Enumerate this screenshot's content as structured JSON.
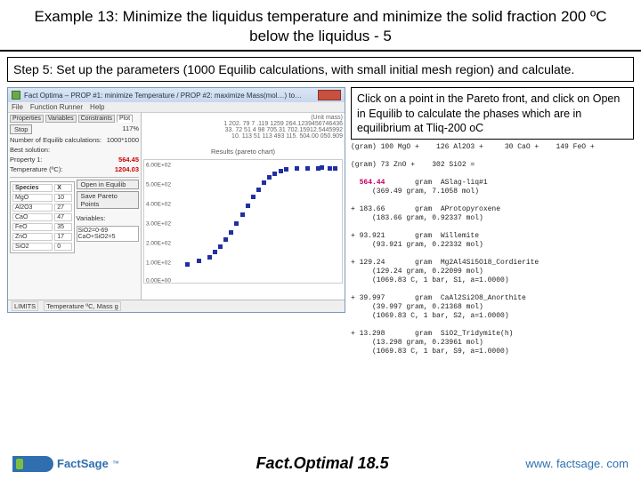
{
  "title": "Example 13: Minimize the liquidus temperature and minimize the solid fraction 200 ºC below the liquidus - 5",
  "step": "Step 5: Set up the parameters (1000 Equilib calculations, with small initial mesh region) and calculate.",
  "hint": "Click on a point in the Pareto front, and click on Open in Equilib to calculate the phases which are in equilibrium at Tliq-200 oC",
  "win": {
    "title": "Fact Optima – PROP #1: minimize Temperature / PROP #2: maximize Mass(mol…) to…",
    "menu": [
      "File",
      "Function Runner",
      "Help"
    ],
    "tabs": [
      "Properties",
      "Variables",
      "Constraints",
      "Plot"
    ],
    "stop": "Stop",
    "pct": "117%",
    "calc_label": "Number of Equilib calculations:",
    "calc_value": "1000*1000",
    "best_label": "Best solution:",
    "prop1_label": "Property 1:",
    "prop1_value": "564.45",
    "prop2_label": "Temperature (ºC):",
    "prop2_value": "1204.03",
    "grid_header": [
      "Species",
      "X"
    ],
    "grid_rows_left": [
      "MgO",
      "Al2O3",
      "CaO",
      "FeO",
      "ZnO",
      "SiO2"
    ],
    "grid_buttons": [
      "Open in Equilib",
      "Save Pareto Points"
    ],
    "variables_label": "Variables:",
    "variables_rows": [
      "SiO2=0-69",
      "CaO+SiO2=5"
    ],
    "status_line1": "1  202. 79 7 .119  1259  264.1239456746436",
    "status_line2": "33.  72  51   4   98  705.31  702.15912.5445992",
    "status_line3": "10.  113  51  113  493  115.  504.00  050.909",
    "status_units": "(Unit mass)",
    "chart_title": "Results (pareto chart)",
    "statusbar": [
      "LIMITS",
      "Temperature ºC, Mass g"
    ]
  },
  "mono_lines": [
    "(gram) 100 MgO +    126 Al2O3 +     30 CaO +    149 FeO +",
    "",
    "(gram) 73 ZnO +    302 SiO2 =",
    "",
    "  <HL>564.44</HL>       gram  ASlag-liq#1",
    "     (369.49 gram, 7.1058 mol)",
    "",
    "+ 183.66       gram  AProtopyroxene",
    "     (183.66 gram, 0.92337 mol)",
    "",
    "+ 93.921       gram  Willemite",
    "     (93.921 gram, 0.22332 mol)",
    "",
    "+ 129.24       gram  Mg2Al4Si5O18_Cordierite",
    "     (129.24 gram, 0.22099 mol)",
    "     (1069.83 C, 1 bar, S1, a=1.0000)",
    "",
    "+ 39.997       gram  CaAl2Si2O8_Anorthite",
    "     (39.997 gram, 0.21368 mol)",
    "     (1069.83 C, 1 bar, S2, a=1.0000)",
    "",
    "+ 13.298       gram  SiO2_Tridymite(h)",
    "     (13.298 gram, 0.23961 mol)",
    "     (1069.83 C, 1 bar, S9, a=1.0000)"
  ],
  "chart_data": {
    "type": "scatter",
    "title": "Results (pareto chart)",
    "xlabel": "",
    "ylabel": "",
    "y_ticks": [
      "6.00E+02",
      "5.00E+02",
      "4.00E+02",
      "3.00E+02",
      "2.00E+02",
      "1.00E+02",
      "0.00E+00"
    ],
    "ylim": [
      0,
      600
    ],
    "xlim": [
      0,
      30
    ],
    "points": [
      {
        "x": 2,
        "y": 20
      },
      {
        "x": 4,
        "y": 40
      },
      {
        "x": 6,
        "y": 60
      },
      {
        "x": 7,
        "y": 90
      },
      {
        "x": 8,
        "y": 120
      },
      {
        "x": 9,
        "y": 160
      },
      {
        "x": 10,
        "y": 200
      },
      {
        "x": 11,
        "y": 250
      },
      {
        "x": 12,
        "y": 300
      },
      {
        "x": 13,
        "y": 350
      },
      {
        "x": 14,
        "y": 400
      },
      {
        "x": 15,
        "y": 440
      },
      {
        "x": 16,
        "y": 480
      },
      {
        "x": 17,
        "y": 510
      },
      {
        "x": 18,
        "y": 530
      },
      {
        "x": 19,
        "y": 545
      },
      {
        "x": 20,
        "y": 555
      },
      {
        "x": 22,
        "y": 560
      },
      {
        "x": 24,
        "y": 562
      },
      {
        "x": 26,
        "y": 563
      },
      {
        "x": 28,
        "y": 564
      },
      {
        "x": 29,
        "y": 564
      },
      {
        "x": 26.5,
        "y": 565
      }
    ]
  },
  "footer": {
    "brand": "FactSage",
    "center": "Fact.Optimal  18.5",
    "site": "www. factsage. com"
  }
}
